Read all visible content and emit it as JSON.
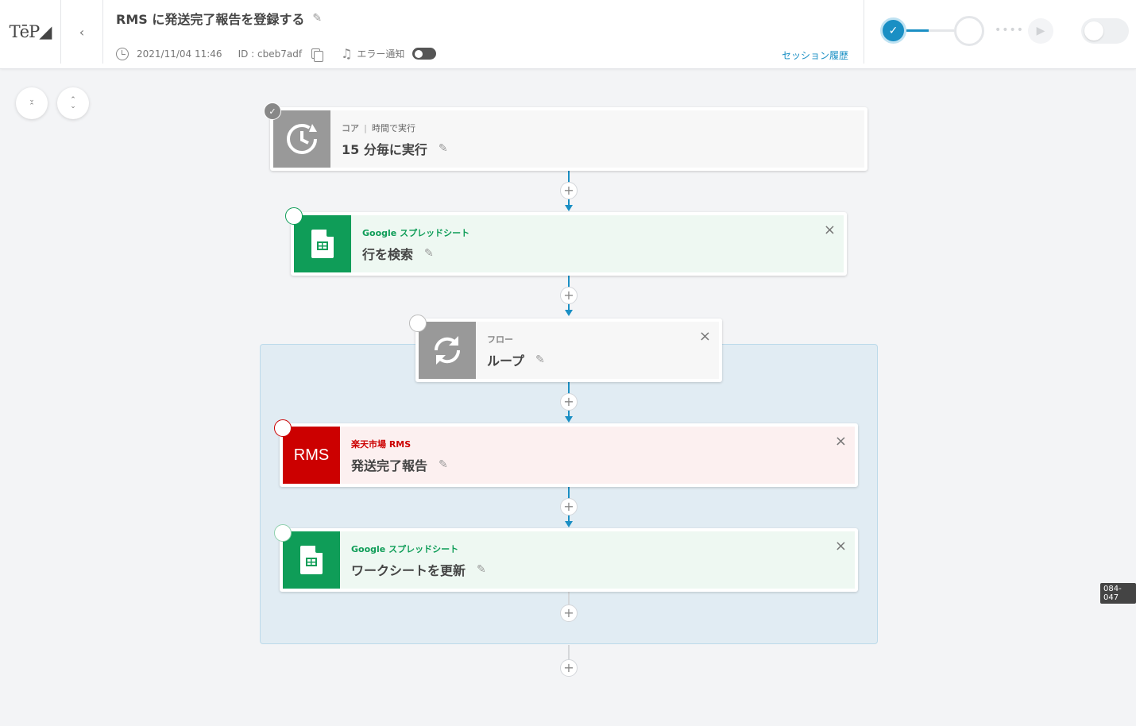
{
  "header": {
    "logo": "TēP◢",
    "back_icon": "‹",
    "flow_title": "RMS に発送完了報告を登録する",
    "edit_icon": "✎",
    "datetime": "2021/11/04 11:46",
    "id_text": "ID : cbeb7adf",
    "error_notify_label": "エラー通知",
    "session_history_label": "セッション履歴"
  },
  "status": {
    "check_icon": "✓",
    "dots": "••••",
    "play_icon": "▶"
  },
  "zoom": {
    "collapse_icon": "⌃⌄",
    "expand_icon": "⌃⌄"
  },
  "nodes": [
    {
      "service": "コア",
      "service_sub": "時間で実行",
      "action": "15 分毎に実行",
      "type": "core"
    },
    {
      "service": "Google スプレッドシート",
      "action": "行を検索",
      "type": "sheets"
    },
    {
      "service": "フロー",
      "action": "ループ",
      "type": "loop"
    },
    {
      "service": "楽天市場 RMS",
      "action": "発送完了報告",
      "icon_text": "RMS",
      "type": "rms"
    },
    {
      "service": "Google スプレッドシート",
      "action": "ワークシートを更新",
      "type": "sheets"
    }
  ],
  "plus_label": "+",
  "close_label": "×",
  "corner_badge": "084-047",
  "colors": {
    "accent": "#1a8fc4",
    "sheets_green": "#0f9d58",
    "rms_red": "#cc0000",
    "core_gray": "#999999"
  }
}
